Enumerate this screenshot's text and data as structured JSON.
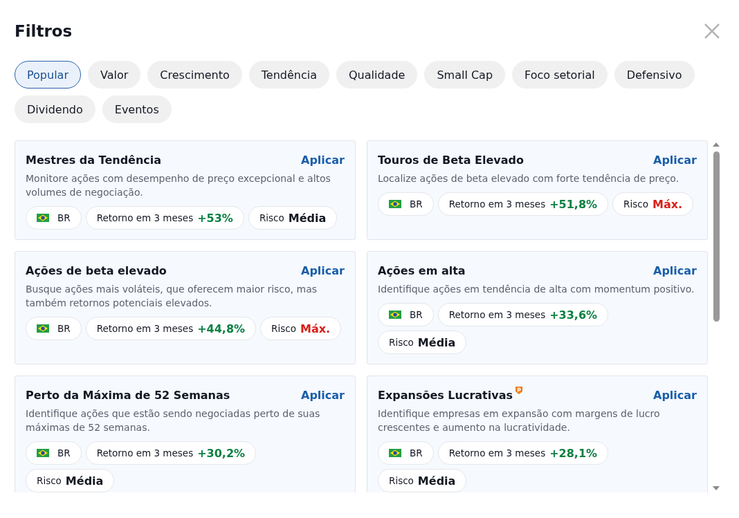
{
  "title": "Filtros",
  "tabs": [
    {
      "label": "Popular",
      "selected": true
    },
    {
      "label": "Valor",
      "selected": false
    },
    {
      "label": "Crescimento",
      "selected": false
    },
    {
      "label": "Tendência",
      "selected": false
    },
    {
      "label": "Qualidade",
      "selected": false
    },
    {
      "label": "Small Cap",
      "selected": false
    },
    {
      "label": "Foco setorial",
      "selected": false
    },
    {
      "label": "Defensivo",
      "selected": false
    },
    {
      "label": "Dividendo",
      "selected": false
    },
    {
      "label": "Eventos",
      "selected": false
    }
  ],
  "cards": [
    {
      "title": "Mestres da Tendência",
      "premium": false,
      "action": "Aplicar",
      "description": "Monitore ações com desempenho de preço excepcional e altos volumes de negociação.",
      "market": "BR",
      "return_label": "Retorno em 3 meses",
      "return_value": "+53%",
      "risk": {
        "label": "Risco",
        "value": "Média",
        "color": "#131722"
      }
    },
    {
      "title": "Touros de Beta Elevado",
      "premium": false,
      "action": "Aplicar",
      "description": "Localize ações de beta elevado com forte tendência de preço.",
      "market": "BR",
      "return_label": "Retorno em 3 meses",
      "return_value": "+51,8%",
      "risk": {
        "label": "Risco",
        "value": "Máx.",
        "color": "#d91e18"
      }
    },
    {
      "title": "Ações de beta elevado",
      "premium": false,
      "action": "Aplicar",
      "description": "Busque ações mais voláteis, que oferecem maior risco, mas também retornos potenciais elevados.",
      "market": "BR",
      "return_label": "Retorno em 3 meses",
      "return_value": "+44,8%",
      "risk": {
        "label": "Risco",
        "value": "Máx.",
        "color": "#d91e18"
      }
    },
    {
      "title": "Ações em alta",
      "premium": false,
      "action": "Aplicar",
      "description": "Identifique ações em tendência de alta com momentum positivo.",
      "market": "BR",
      "return_label": "Retorno em 3 meses",
      "return_value": "+33,6%",
      "risk": {
        "label": "Risco",
        "value": "Média",
        "color": "#131722"
      }
    },
    {
      "title": "Perto da Máxima de 52 Semanas",
      "premium": false,
      "action": "Aplicar",
      "description": "Identifique ações que estão sendo negociadas perto de suas máximas de 52 semanas.",
      "market": "BR",
      "return_label": "Retorno em 3 meses",
      "return_value": "+30,2%",
      "risk": {
        "label": "Risco",
        "value": "Média",
        "color": "#131722"
      }
    },
    {
      "title": "Expansões Lucrativas",
      "premium": true,
      "action": "Aplicar",
      "description": "Identifique empresas em expansão com margens de lucro crescentes e aumento na lucratividade.",
      "market": "BR",
      "return_label": "Retorno em 3 meses",
      "return_value": "+28,1%",
      "risk": {
        "label": "Risco",
        "value": "Média",
        "color": "#131722"
      }
    }
  ]
}
